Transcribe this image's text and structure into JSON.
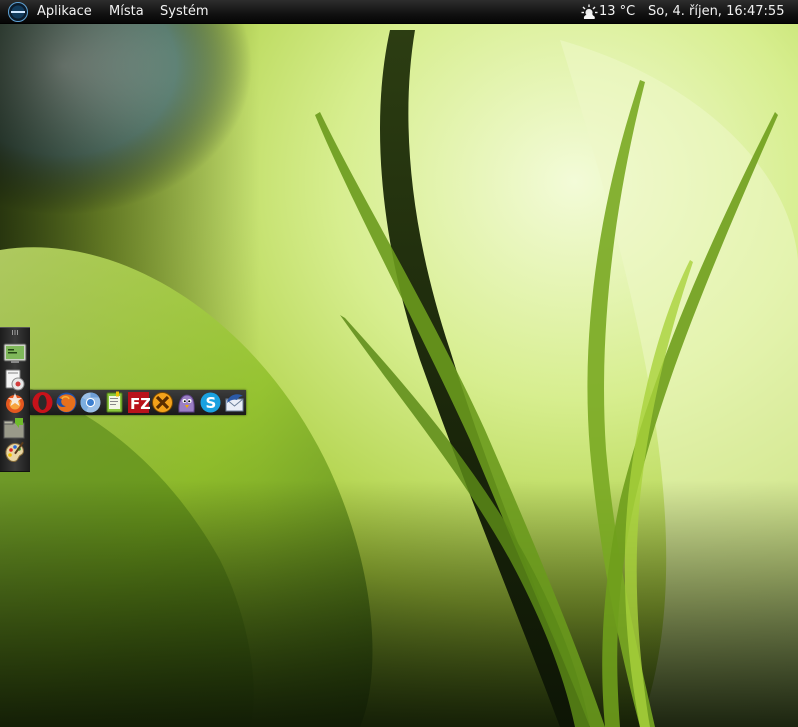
{
  "top_panel": {
    "menus": {
      "applications": "Aplikace",
      "places": "Místa",
      "system": "Systém"
    },
    "weather": {
      "icon": "sun-cloud-icon",
      "temperature": "13 °C"
    },
    "clock": "So,  4. říjen, 16:47:55"
  },
  "left_dock": {
    "items": [
      "terminal-icon",
      "drive-properties-icon",
      "firefox-star-icon",
      "file-manager-icon",
      "paint-palette-icon"
    ]
  },
  "launcher_bar": {
    "items": [
      "opera-icon",
      "firefox-icon",
      "chromium-icon",
      "text-editor-icon",
      "filezilla-icon",
      "crossover-icon",
      "pidgin-icon",
      "skype-icon",
      "thunderbird-icon"
    ]
  },
  "colors": {
    "panel": "#111111",
    "panel_text": "#f2f2f2",
    "wallpaper_accent": "#b9d84a"
  }
}
